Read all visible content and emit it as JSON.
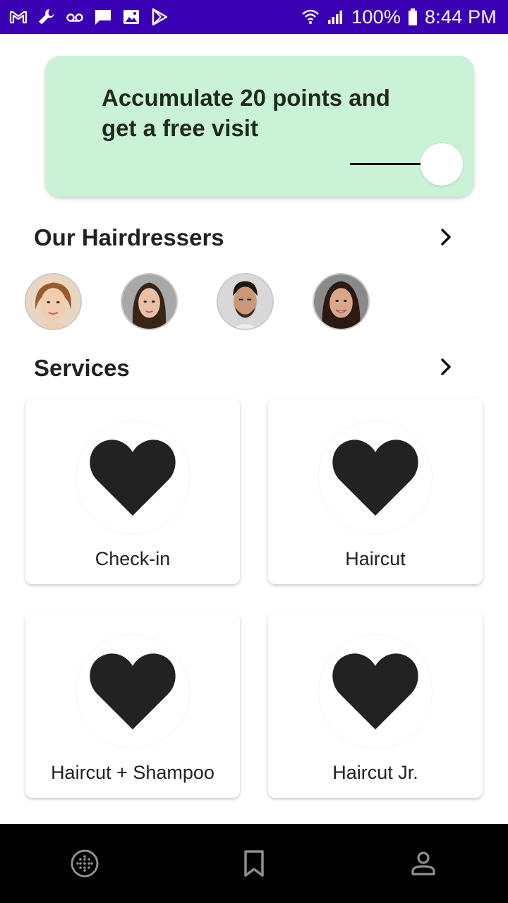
{
  "status_bar": {
    "left_icons": [
      "gmail-icon",
      "wrench-icon",
      "voicemail-icon",
      "message-icon",
      "image-icon",
      "play-store-icon"
    ],
    "battery_percent": "100%",
    "time": "8:44 PM",
    "background_color": "#3a00b4"
  },
  "promo": {
    "text": "Accumulate 20 points and get a free visit",
    "background_color": "#c9f2d6"
  },
  "hairdressers": {
    "title": "Our Hairdressers",
    "items": [
      {
        "icon": "hairdresser-avatar"
      },
      {
        "icon": "hairdresser-avatar"
      },
      {
        "icon": "hairdresser-avatar"
      },
      {
        "icon": "hairdresser-avatar"
      }
    ]
  },
  "services": {
    "title": "Services",
    "items": [
      {
        "label": "Check-in",
        "icon": "heart-icon"
      },
      {
        "label": "Haircut",
        "icon": "heart-icon"
      },
      {
        "label": "Haircut + Shampoo",
        "icon": "heart-icon"
      },
      {
        "label": "Haircut Jr.",
        "icon": "heart-icon"
      }
    ]
  },
  "bottom_nav": {
    "items": [
      {
        "icon": "grid-circle-icon"
      },
      {
        "icon": "bookmark-icon"
      },
      {
        "icon": "person-icon"
      }
    ]
  }
}
